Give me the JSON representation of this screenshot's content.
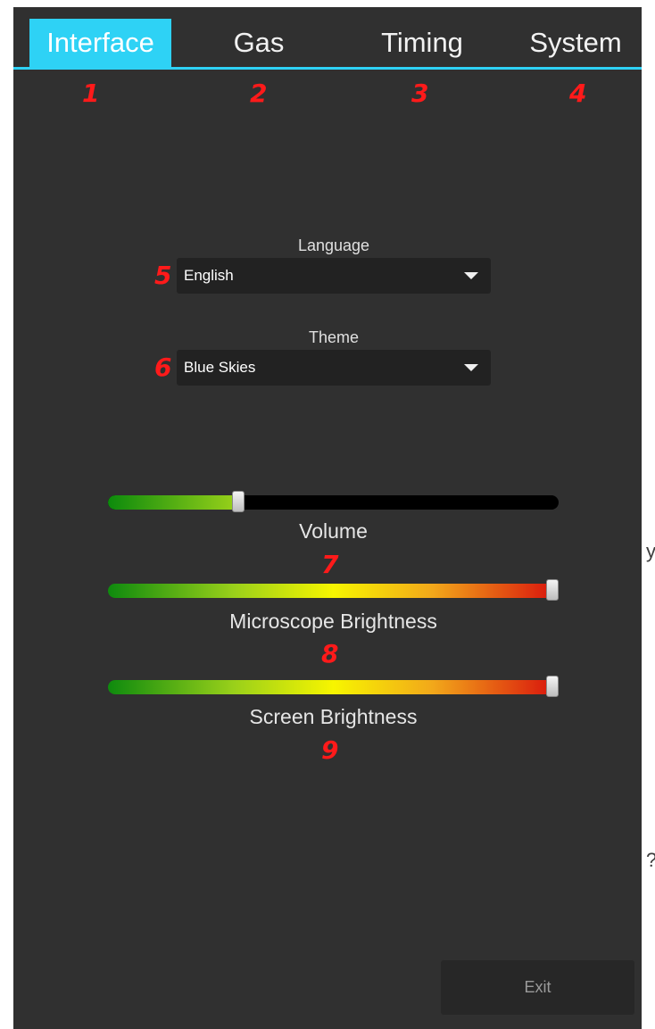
{
  "tabs": [
    {
      "label": "Interface",
      "active": true
    },
    {
      "label": "Gas",
      "active": false
    },
    {
      "label": "Timing",
      "active": false
    },
    {
      "label": "System",
      "active": false
    }
  ],
  "accent_color": "#2ed2f5",
  "marker_color": "#ff1a1a",
  "markers": [
    "1",
    "2",
    "3",
    "4",
    "5",
    "6",
    "7",
    "8",
    "9"
  ],
  "language": {
    "label": "Language",
    "value": "English"
  },
  "theme": {
    "label": "Theme",
    "value": "Blue Skies"
  },
  "sliders": [
    {
      "label": "Volume",
      "level": 0.29
    },
    {
      "label": "Microscope Brightness",
      "level": 1.0
    },
    {
      "label": "Screen Brightness",
      "level": 1.0
    }
  ],
  "exit_label": "Exit",
  "edge_glyphs": [
    "y",
    "?"
  ],
  "icons": {
    "dropdown": "chevron-down-icon",
    "slider_thumb": "slider-thumb"
  }
}
